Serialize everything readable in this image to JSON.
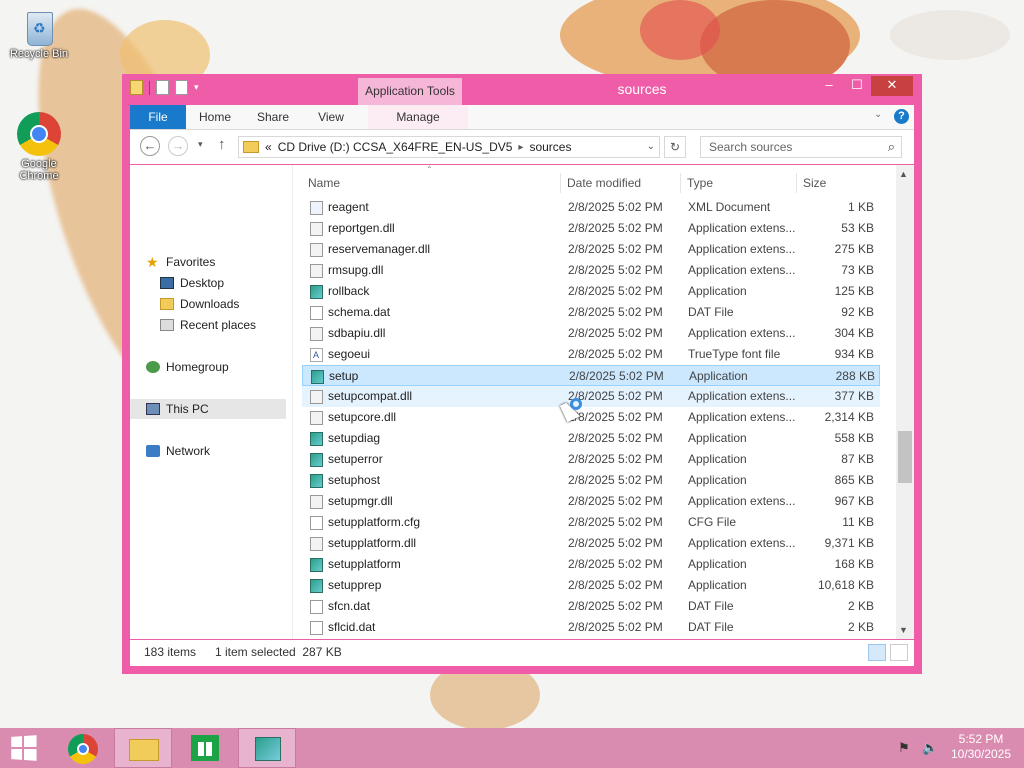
{
  "desktop": {
    "icons": [
      {
        "label": "Recycle Bin"
      },
      {
        "label": "Google Chrome"
      }
    ]
  },
  "window": {
    "title": "sources",
    "contextual_tab_group": "Application Tools",
    "ribbon_tabs": [
      "File",
      "Home",
      "Share",
      "View",
      "Manage"
    ],
    "address_crumbs": [
      "«",
      "CD Drive (D:) CCSA_X64FRE_EN-US_DV5",
      "sources"
    ],
    "search_placeholder": "Search sources",
    "accent_color": "#ef5da8"
  },
  "nav": {
    "favorites": "Favorites",
    "desktop": "Desktop",
    "downloads": "Downloads",
    "recent": "Recent places",
    "homegroup": "Homegroup",
    "this_pc": "This PC",
    "network": "Network"
  },
  "columns": {
    "name": "Name",
    "date": "Date modified",
    "type": "Type",
    "size": "Size"
  },
  "files": [
    {
      "name": "reagent",
      "date": "2/8/2025 5:02 PM",
      "type": "XML Document",
      "size": "1 KB",
      "icon": "xml-file-icon"
    },
    {
      "name": "reportgen.dll",
      "date": "2/8/2025 5:02 PM",
      "type": "Application extens...",
      "size": "53 KB",
      "icon": "dll-file-icon"
    },
    {
      "name": "reservemanager.dll",
      "date": "2/8/2025 5:02 PM",
      "type": "Application extens...",
      "size": "275 KB",
      "icon": "dll-file-icon"
    },
    {
      "name": "rmsupg.dll",
      "date": "2/8/2025 5:02 PM",
      "type": "Application extens...",
      "size": "73 KB",
      "icon": "dll-file-icon"
    },
    {
      "name": "rollback",
      "date": "2/8/2025 5:02 PM",
      "type": "Application",
      "size": "125 KB",
      "icon": "app-file-icon"
    },
    {
      "name": "schema.dat",
      "date": "2/8/2025 5:02 PM",
      "type": "DAT File",
      "size": "92 KB",
      "icon": "dat-file-icon"
    },
    {
      "name": "sdbapiu.dll",
      "date": "2/8/2025 5:02 PM",
      "type": "Application extens...",
      "size": "304 KB",
      "icon": "dll-file-icon"
    },
    {
      "name": "segoeui",
      "date": "2/8/2025 5:02 PM",
      "type": "TrueType font file",
      "size": "934 KB",
      "icon": "font-file-icon"
    },
    {
      "name": "setup",
      "date": "2/8/2025 5:02 PM",
      "type": "Application",
      "size": "288 KB",
      "icon": "app-file-icon"
    },
    {
      "name": "setupcompat.dll",
      "date": "2/8/2025 5:02 PM",
      "type": "Application extens...",
      "size": "377 KB",
      "icon": "dll-file-icon"
    },
    {
      "name": "setupcore.dll",
      "date": "2/8/2025 5:02 PM",
      "type": "Application extens...",
      "size": "2,314 KB",
      "icon": "dll-file-icon"
    },
    {
      "name": "setupdiag",
      "date": "2/8/2025 5:02 PM",
      "type": "Application",
      "size": "558 KB",
      "icon": "app-file-icon"
    },
    {
      "name": "setuperror",
      "date": "2/8/2025 5:02 PM",
      "type": "Application",
      "size": "87 KB",
      "icon": "app-file-icon"
    },
    {
      "name": "setuphost",
      "date": "2/8/2025 5:02 PM",
      "type": "Application",
      "size": "865 KB",
      "icon": "app-file-icon"
    },
    {
      "name": "setupmgr.dll",
      "date": "2/8/2025 5:02 PM",
      "type": "Application extens...",
      "size": "967 KB",
      "icon": "dll-file-icon"
    },
    {
      "name": "setupplatform.cfg",
      "date": "2/8/2025 5:02 PM",
      "type": "CFG File",
      "size": "11 KB",
      "icon": "cfg-file-icon"
    },
    {
      "name": "setupplatform.dll",
      "date": "2/8/2025 5:02 PM",
      "type": "Application extens...",
      "size": "9,371 KB",
      "icon": "dll-file-icon"
    },
    {
      "name": "setupplatform",
      "date": "2/8/2025 5:02 PM",
      "type": "Application",
      "size": "168 KB",
      "icon": "app-file-icon"
    },
    {
      "name": "setupprep",
      "date": "2/8/2025 5:02 PM",
      "type": "Application",
      "size": "10,618 KB",
      "icon": "app-file-icon"
    },
    {
      "name": "sfcn.dat",
      "date": "2/8/2025 5:02 PM",
      "type": "DAT File",
      "size": "2 KB",
      "icon": "dat-file-icon"
    },
    {
      "name": "sflcid.dat",
      "date": "2/8/2025 5:02 PM",
      "type": "DAT File",
      "size": "2 KB",
      "icon": "dat-file-icon"
    }
  ],
  "selected_file": "setup",
  "hovered_file": "setupcompat.dll",
  "status": {
    "count": "183 items",
    "selection": "1 item selected  287 KB"
  },
  "taskbar": {
    "time": "5:52 PM",
    "date": "10/30/2025"
  }
}
